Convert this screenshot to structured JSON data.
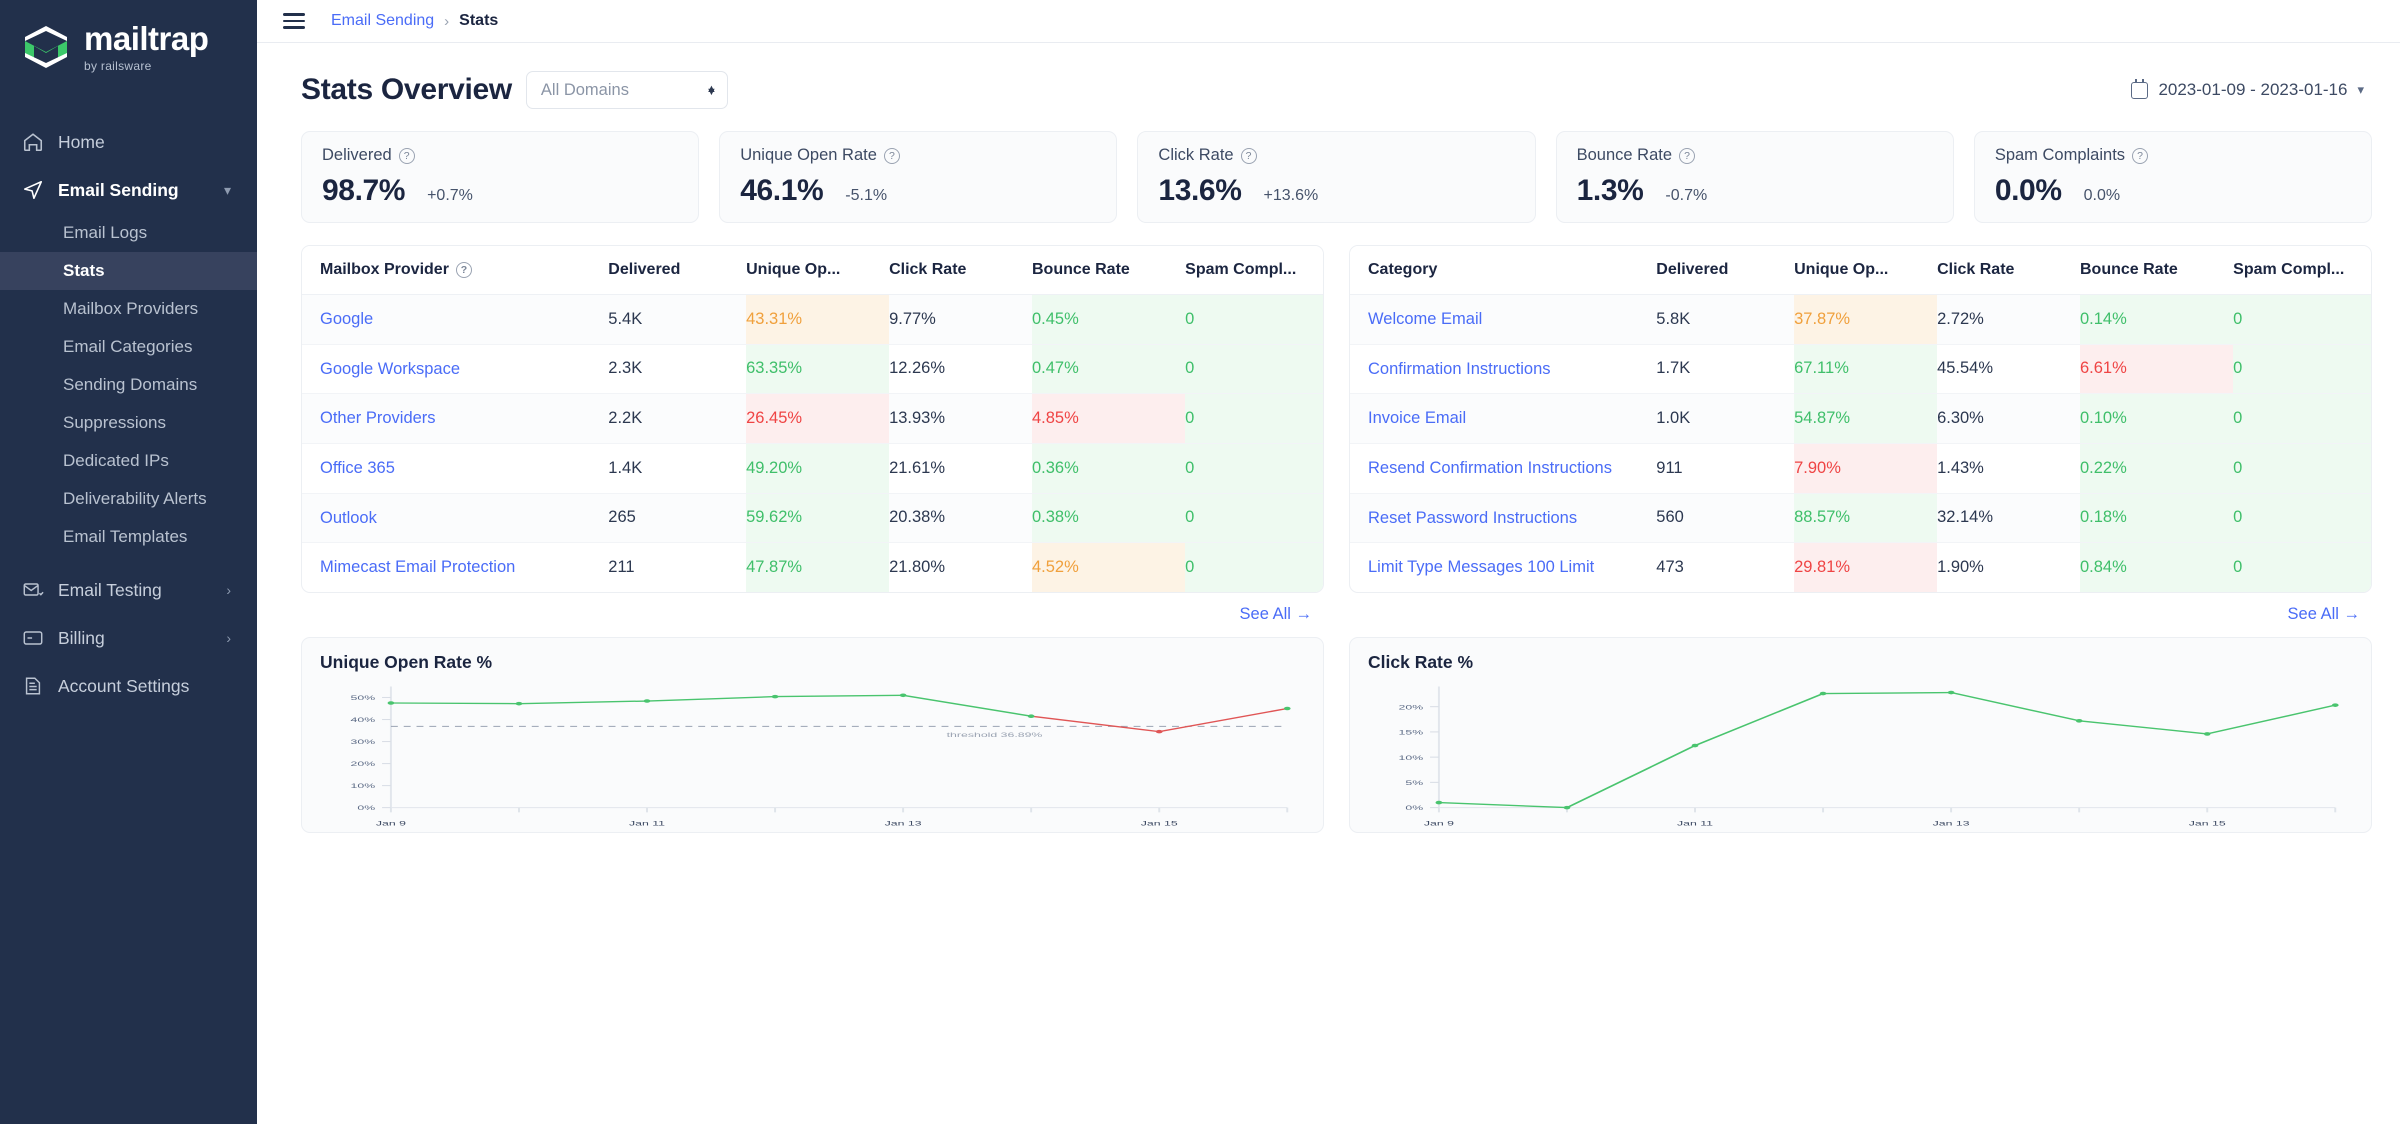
{
  "brand": {
    "name": "mailtrap",
    "tagline": "by railsware",
    "logo_icon": "mailtrap-logo-icon",
    "accent": "#3cc86a",
    "sidebar_bg": "#22304b",
    "link_color": "#4a6cf7"
  },
  "sidebar": {
    "items": [
      {
        "label": "Home",
        "icon": "home-icon",
        "type": "top",
        "state": ""
      },
      {
        "label": "Email Sending",
        "icon": "paper-plane-icon",
        "type": "top",
        "state": "expanded",
        "chevron": "chevron-down"
      },
      {
        "label": "Email Logs",
        "icon": "",
        "type": "sub",
        "state": ""
      },
      {
        "label": "Stats",
        "icon": "",
        "type": "sub",
        "state": "selected"
      },
      {
        "label": "Mailbox Providers",
        "icon": "",
        "type": "sub",
        "state": ""
      },
      {
        "label": "Email Categories",
        "icon": "",
        "type": "sub",
        "state": ""
      },
      {
        "label": "Sending Domains",
        "icon": "",
        "type": "sub",
        "state": ""
      },
      {
        "label": "Suppressions",
        "icon": "",
        "type": "sub",
        "state": ""
      },
      {
        "label": "Dedicated IPs",
        "icon": "",
        "type": "sub",
        "state": ""
      },
      {
        "label": "Deliverability Alerts",
        "icon": "",
        "type": "sub",
        "state": ""
      },
      {
        "label": "Email Templates",
        "icon": "",
        "type": "sub",
        "state": ""
      },
      {
        "label": "Email Testing",
        "icon": "envelope-check-icon",
        "type": "top",
        "state": "",
        "chevron": "chevron-right"
      },
      {
        "label": "Billing",
        "icon": "credit-card-icon",
        "type": "top",
        "state": "",
        "chevron": "chevron-right"
      },
      {
        "label": "Account Settings",
        "icon": "document-icon",
        "type": "top",
        "state": ""
      }
    ]
  },
  "topbar": {
    "menu_icon": "hamburger-icon",
    "breadcrumb_parent": "Email Sending",
    "breadcrumb_sep": "›",
    "breadcrumb_current": "Stats"
  },
  "page": {
    "title": "Stats Overview",
    "domain_filter": {
      "value": "All Domains",
      "icon": "select-stepper-icon"
    },
    "date_range": {
      "value": "2023-01-09 - 2023-01-16",
      "icon": "calendar-icon",
      "chevron": "chevron-down-icon"
    }
  },
  "kpis": [
    {
      "label": "Delivered",
      "value": "98.7%",
      "delta": "+0.7%",
      "info_icon": "question-circle-icon"
    },
    {
      "label": "Unique Open Rate",
      "value": "46.1%",
      "delta": "-5.1%",
      "info_icon": "question-circle-icon"
    },
    {
      "label": "Click Rate",
      "value": "13.6%",
      "delta": "+13.6%",
      "info_icon": "question-circle-icon"
    },
    {
      "label": "Bounce Rate",
      "value": "1.3%",
      "delta": "-0.7%",
      "info_icon": "question-circle-icon"
    },
    {
      "label": "Spam Complaints",
      "value": "0.0%",
      "delta": "0.0%",
      "info_icon": "question-circle-icon"
    }
  ],
  "provider_table": {
    "columns": [
      "Mailbox Provider",
      "Delivered",
      "Unique Op...",
      "Click Rate",
      "Bounce Rate",
      "Spam Compl..."
    ],
    "header_info_icon": "question-circle-icon",
    "see_all": "See All →",
    "rows": [
      {
        "name": "Google",
        "delivered": "5.4K",
        "open": "43.31%",
        "open_tone": "warn",
        "click": "9.77%",
        "click_tone": "plain",
        "bounce": "0.45%",
        "bounce_tone": "good",
        "spam": "0",
        "spam_tone": "good"
      },
      {
        "name": "Google Workspace",
        "delivered": "2.3K",
        "open": "63.35%",
        "open_tone": "good",
        "click": "12.26%",
        "click_tone": "plain",
        "bounce": "0.47%",
        "bounce_tone": "good",
        "spam": "0",
        "spam_tone": "good"
      },
      {
        "name": "Other Providers",
        "delivered": "2.2K",
        "open": "26.45%",
        "open_tone": "bad",
        "click": "13.93%",
        "click_tone": "plain",
        "bounce": "4.85%",
        "bounce_tone": "bad",
        "spam": "0",
        "spam_tone": "good"
      },
      {
        "name": "Office 365",
        "delivered": "1.4K",
        "open": "49.20%",
        "open_tone": "good",
        "click": "21.61%",
        "click_tone": "plain",
        "bounce": "0.36%",
        "bounce_tone": "good",
        "spam": "0",
        "spam_tone": "good"
      },
      {
        "name": "Outlook",
        "delivered": "265",
        "open": "59.62%",
        "open_tone": "good",
        "click": "20.38%",
        "click_tone": "plain",
        "bounce": "0.38%",
        "bounce_tone": "good",
        "spam": "0",
        "spam_tone": "good"
      },
      {
        "name": "Mimecast Email Protection",
        "delivered": "211",
        "open": "47.87%",
        "open_tone": "good",
        "click": "21.80%",
        "click_tone": "plain",
        "bounce": "4.52%",
        "bounce_tone": "warn",
        "spam": "0",
        "spam_tone": "good"
      }
    ]
  },
  "category_table": {
    "columns": [
      "Category",
      "Delivered",
      "Unique Op...",
      "Click Rate",
      "Bounce Rate",
      "Spam Compl..."
    ],
    "see_all": "See All →",
    "rows": [
      {
        "name": "Welcome Email",
        "delivered": "5.8K",
        "open": "37.87%",
        "open_tone": "warn",
        "click": "2.72%",
        "click_tone": "plain",
        "bounce": "0.14%",
        "bounce_tone": "good",
        "spam": "0",
        "spam_tone": "good"
      },
      {
        "name": "Confirmation Instructions",
        "delivered": "1.7K",
        "open": "67.11%",
        "open_tone": "good",
        "click": "45.54%",
        "click_tone": "plain",
        "bounce": "6.61%",
        "bounce_tone": "bad",
        "spam": "0",
        "spam_tone": "good"
      },
      {
        "name": "Invoice Email",
        "delivered": "1.0K",
        "open": "54.87%",
        "open_tone": "good",
        "click": "6.30%",
        "click_tone": "plain",
        "bounce": "0.10%",
        "bounce_tone": "good",
        "spam": "0",
        "spam_tone": "good"
      },
      {
        "name": "Resend Confirmation Instructions",
        "delivered": "911",
        "open": "7.90%",
        "open_tone": "bad",
        "click": "1.43%",
        "click_tone": "plain",
        "bounce": "0.22%",
        "bounce_tone": "good",
        "spam": "0",
        "spam_tone": "good"
      },
      {
        "name": "Reset Password Instructions",
        "delivered": "560",
        "open": "88.57%",
        "open_tone": "good",
        "click": "32.14%",
        "click_tone": "plain",
        "bounce": "0.18%",
        "bounce_tone": "good",
        "spam": "0",
        "spam_tone": "good"
      },
      {
        "name": "Limit Type Messages 100 Limit",
        "delivered": "473",
        "open": "29.81%",
        "open_tone": "bad",
        "click": "1.90%",
        "click_tone": "plain",
        "bounce": "0.84%",
        "bounce_tone": "good",
        "spam": "0",
        "spam_tone": "good"
      }
    ]
  },
  "chart_data": [
    {
      "type": "line",
      "title": "Unique Open Rate %",
      "xlabel": "",
      "ylabel": "",
      "x": [
        "Jan 9",
        "Jan 10",
        "Jan 11",
        "Jan 12",
        "Jan 13",
        "Jan 14",
        "Jan 15",
        "Jan 16"
      ],
      "xtick_labels": [
        "Jan 9",
        "Jan 11",
        "Jan 13",
        "Jan 15"
      ],
      "ytick_labels": [
        "0%",
        "10%",
        "20%",
        "30%",
        "40%",
        "50%"
      ],
      "ylim": [
        0,
        55
      ],
      "yticks": [
        0,
        10,
        20,
        30,
        40,
        50
      ],
      "grid": false,
      "legend": "none",
      "series": [
        {
          "name": "Unique Open Rate",
          "values": [
            47.5,
            47.2,
            48.4,
            50.4,
            51.0,
            41.5,
            34.5,
            45.0
          ],
          "color": "#49c46e"
        }
      ],
      "segment_colors": [
        "#49c46e",
        "#49c46e",
        "#49c46e",
        "#49c46e",
        "#49c46e",
        "#e05555",
        "#e05555"
      ],
      "threshold": {
        "value": 36.89,
        "label": "threshold 36.89%",
        "style": "dashed",
        "color": "#9aa3b2"
      }
    },
    {
      "type": "line",
      "title": "Click Rate %",
      "xlabel": "",
      "ylabel": "",
      "x": [
        "Jan 9",
        "Jan 10",
        "Jan 11",
        "Jan 12",
        "Jan 13",
        "Jan 14",
        "Jan 15",
        "Jan 16"
      ],
      "xtick_labels": [
        "Jan 9",
        "Jan 11",
        "Jan 13",
        "Jan 15"
      ],
      "ytick_labels": [
        "0%",
        "5%",
        "10%",
        "15%",
        "20%"
      ],
      "ylim": [
        0,
        24
      ],
      "yticks": [
        0,
        5,
        10,
        15,
        20
      ],
      "grid": false,
      "legend": "none",
      "series": [
        {
          "name": "Click Rate",
          "values": [
            1.0,
            0.0,
            12.3,
            22.6,
            22.8,
            17.2,
            14.6,
            20.3
          ],
          "color": "#49c46e"
        }
      ],
      "threshold": null
    }
  ]
}
